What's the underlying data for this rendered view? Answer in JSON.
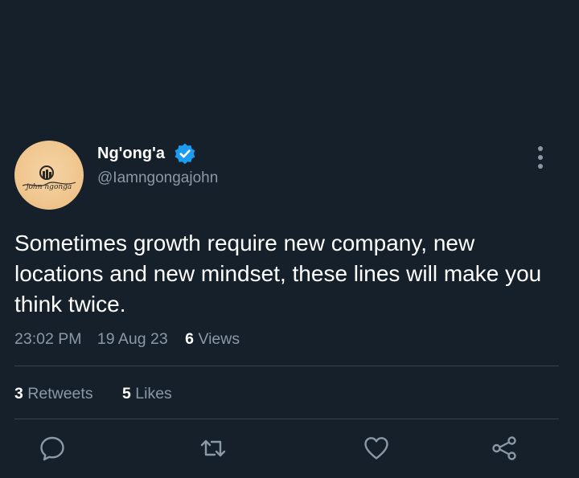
{
  "author": {
    "display_name": "Ng'ong'a",
    "handle": "@Iamngongajohn",
    "verified": true,
    "avatar_text": "john ngonga"
  },
  "tweet": {
    "text": "Sometimes growth require new company, new locations and new mindset, these lines will make you think twice.",
    "time": "23:02 PM",
    "date": "19 Aug 23",
    "views_count": "6",
    "views_label": "Views"
  },
  "stats": {
    "retweets_count": "3",
    "retweets_label": "Retweets",
    "likes_count": "5",
    "likes_label": "Likes"
  },
  "icons": {
    "more": "more-vertical-icon",
    "verified": "verified-badge-icon",
    "reply": "reply-icon",
    "retweet": "retweet-icon",
    "like": "heart-icon",
    "share": "share-icon"
  },
  "colors": {
    "background": "#15202b",
    "text_primary": "#ffffff",
    "text_secondary": "#8b98a5",
    "verified_blue": "#1d9bf0",
    "divider": "#38444d"
  }
}
